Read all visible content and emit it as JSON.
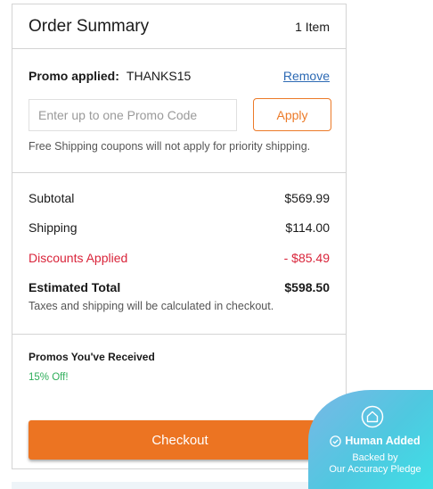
{
  "summary": {
    "title": "Order Summary",
    "item_count": "1 Item"
  },
  "promo": {
    "applied_label": "Promo applied:",
    "applied_code": "THANKS15",
    "remove_label": "Remove",
    "input_placeholder": "Enter up to one Promo Code",
    "apply_label": "Apply",
    "note": "Free Shipping coupons will not apply for priority shipping."
  },
  "totals": {
    "subtotal_label": "Subtotal",
    "subtotal_value": "$569.99",
    "shipping_label": "Shipping",
    "shipping_value": "$114.00",
    "discounts_label": "Discounts Applied",
    "discounts_value": "- $85.49",
    "estimated_label": "Estimated Total",
    "estimated_value": "$598.50",
    "tax_note": "Taxes and shipping will be calculated in checkout."
  },
  "received": {
    "heading": "Promos You've Received",
    "items": [
      "15% Off!"
    ]
  },
  "checkout": {
    "label": "Checkout"
  },
  "badge": {
    "title": "Human Added",
    "line1": "Backed by",
    "line2": "Our Accuracy Pledge",
    "icon": "house-icon",
    "check_icon": "check-circle-icon"
  },
  "colors": {
    "accent_orange": "#ec7422",
    "discount_red": "#d9243a",
    "promo_green": "#2eae5a",
    "link_blue": "#2d6ab4",
    "badge_gradient_start": "#7ab7e6",
    "badge_gradient_end": "#3ee0e6"
  }
}
